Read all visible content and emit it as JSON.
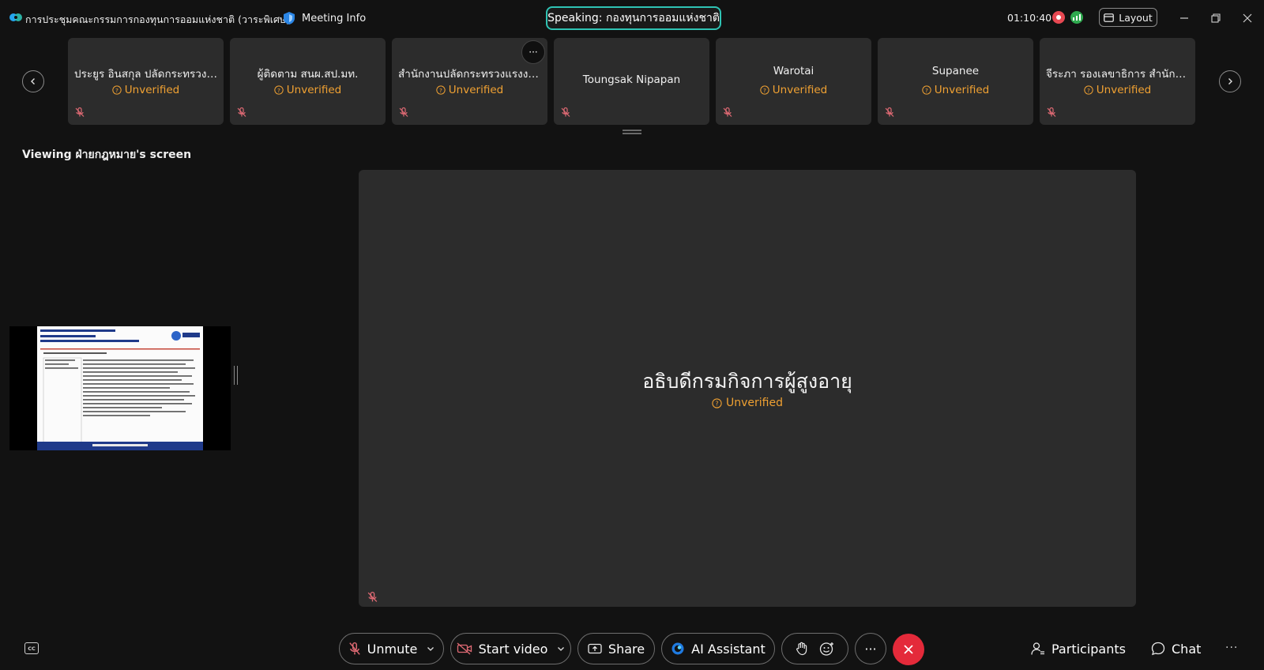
{
  "header": {
    "meeting_title": "การประชุมคณะกรรมการกองทุนการออมแห่งชาติ (วาระพิเศษ)",
    "meeting_info_label": "Meeting Info",
    "speaking_label": "Speaking: กองทุนการออมแห่งชาติ",
    "timer": "01:10:40",
    "layout_label": "Layout"
  },
  "participants": [
    {
      "name": "ประยูร อินสกุล ปลัดกระทรวงแ...",
      "status": "Unverified"
    },
    {
      "name": "ผู้ติดตาม สนผ.สป.มท.",
      "status": "Unverified"
    },
    {
      "name": "สำนักงานปลัดกระทรวงแรงงาน",
      "status": "Unverified"
    },
    {
      "name": "Toungsak Nipapan",
      "status": ""
    },
    {
      "name": "Warotai",
      "status": "Unverified"
    },
    {
      "name": "Supanee",
      "status": "Unverified"
    },
    {
      "name": "จีระภา รองเลขาธิการ สำนักง...",
      "status": "Unverified"
    }
  ],
  "tile_more_label": "···",
  "viewing": {
    "label": "Viewing ฝ่ายกฎหมาย's screen"
  },
  "main_tile": {
    "name": "อธิบดีกรมกิจการผู้สูงอายุ",
    "status": "Unverified"
  },
  "controls": {
    "cc_label": "CC",
    "unmute": "Unmute",
    "start_video": "Start video",
    "share": "Share",
    "ai_assistant": "AI Assistant",
    "more": "···",
    "participants": "Participants",
    "chat": "Chat",
    "overflow": "···"
  },
  "colors": {
    "accent_teal": "#2fc3b4",
    "unverified": "#f0a132",
    "end_call": "#e42a3a",
    "recording": "#e74852",
    "muted_mic": "#e06a74"
  }
}
